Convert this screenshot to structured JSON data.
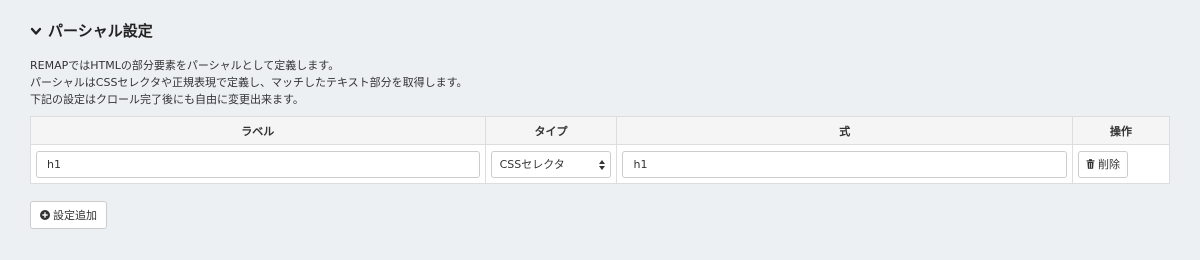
{
  "section": {
    "title": "パーシャル設定",
    "toggle_icon": "chevron-down-icon"
  },
  "description": {
    "lines": [
      "REMAPではHTMLの部分要素をパーシャルとして定義します。",
      "パーシャルはCSSセレクタや正規表現で定義し、マッチしたテキスト部分を取得します。",
      "下記の設定はクロール完了後にも自由に変更出来ます。"
    ]
  },
  "table": {
    "headers": {
      "label": "ラベル",
      "type": "タイプ",
      "expression": "式",
      "actions": "操作"
    },
    "rows": [
      {
        "label": "h1",
        "type": "CSSセレクタ",
        "expression": "h1",
        "delete_label": "削除",
        "delete_icon": "trash-icon"
      }
    ]
  },
  "add_button": {
    "label": "設定追加",
    "icon": "plus-circle-icon"
  }
}
